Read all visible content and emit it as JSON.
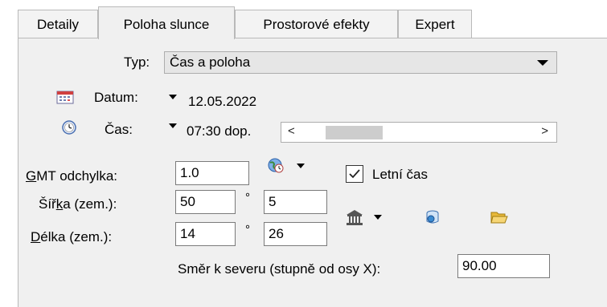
{
  "tabs": [
    {
      "label": "Detaily"
    },
    {
      "label": "Poloha slunce",
      "active": true
    },
    {
      "label": "Prostorové efekty"
    },
    {
      "label": "Expert"
    }
  ],
  "typ": {
    "label": "Typ:",
    "value": "Čas a poloha"
  },
  "datum": {
    "label": "Datum:",
    "value": "12.05.2022"
  },
  "cas": {
    "label": "Čas:",
    "value": "07:30 dop.",
    "scroll_left": "<",
    "scroll_right": ">"
  },
  "gmt": {
    "label_u": "G",
    "label_rest": "MT odchylka:",
    "value": "1.0"
  },
  "letni_cas": {
    "label": "Letní čas",
    "checked": true
  },
  "sirka": {
    "label_pre": "Šíř",
    "label_u": "k",
    "label_post": "a (zem.):",
    "deg": "50",
    "deg_symbol": "°",
    "min": "5"
  },
  "delka": {
    "label_u": "D",
    "label_rest": "élka (zem.):",
    "deg": "14",
    "deg_symbol": "°",
    "min": "26"
  },
  "sever": {
    "label": "Směr k severu (stupně od osy X):",
    "value": "90.00"
  },
  "icons": {
    "calendar": "calendar-icon",
    "clock": "clock-icon",
    "globe": "globe-time-icon",
    "building": "building-icon",
    "database": "database-icon",
    "folder": "folder-open-icon"
  },
  "colors": {
    "panel_bg": "#f0f0f0",
    "tab_border": "#b9b9b9",
    "combo_bg": "#e6e6e6"
  }
}
